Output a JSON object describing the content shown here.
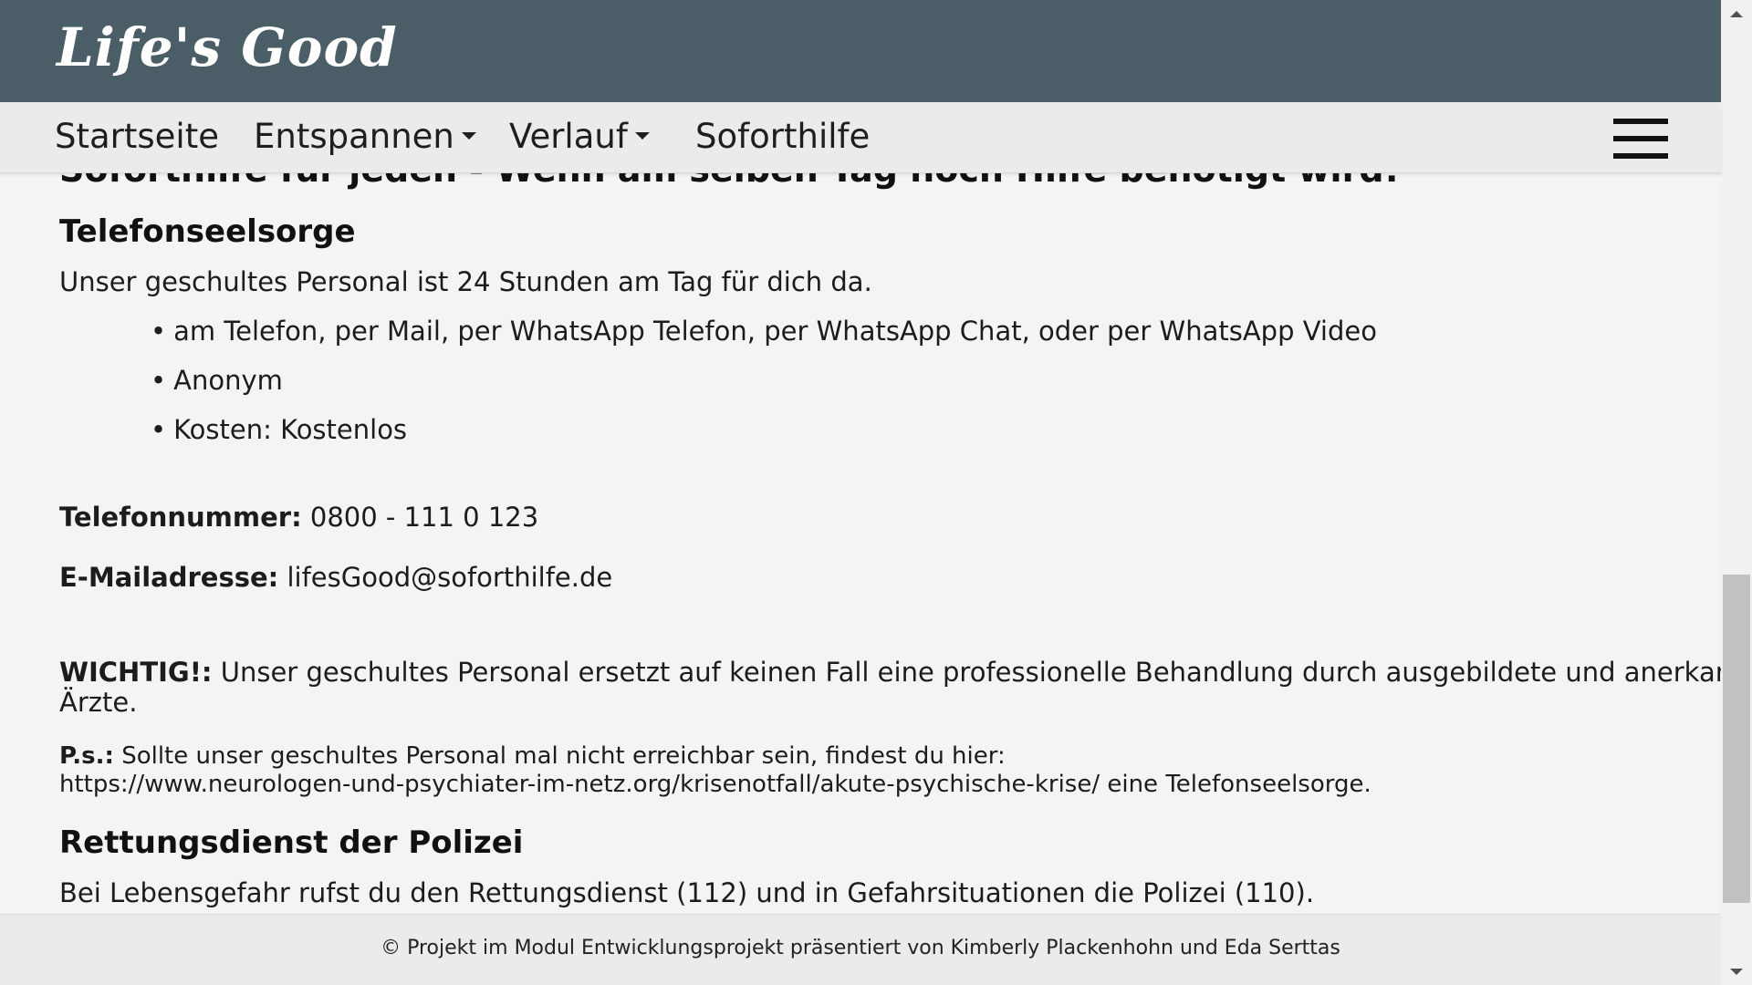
{
  "header": {
    "logo": "Life's Good"
  },
  "nav": {
    "items": [
      {
        "label": "Startseite"
      },
      {
        "label": "Entspannen"
      },
      {
        "label": "Verlauf"
      },
      {
        "label": "Soforthilfe"
      }
    ]
  },
  "main": {
    "clipped_heading": "Soforthilfe für jeden - Wenn am selben Tag noch Hilfe benötigt wird!",
    "section1": {
      "title": "Telefonseelsorge",
      "intro": "Unser geschultes Personal ist 24 Stunden am Tag für dich da.",
      "bullets": [
        "am Telefon, per Mail, per WhatsApp Telefon, per WhatsApp Chat, oder per WhatsApp Video",
        "Anonym",
        "Kosten: Kostenlos"
      ],
      "phone_label": "Telefonnummer:",
      "phone_value": "0800 - 111 0 123",
      "email_label": "E-Mailadresse:",
      "email_value": "lifesGood@soforthilfe.de",
      "important_label": "WICHTIG!:",
      "important_text_line1": "Unser geschultes Personal ersetzt auf keinen Fall eine professionelle Behandlung durch ausgebildete und anerkannte",
      "important_text_line2": "Ärzte.",
      "ps_label": "P.s.:",
      "ps_text_line1": "Sollte unser geschultes Personal mal nicht erreichbar sein, findest du hier:",
      "ps_text_line2": "https://www.neurologen-und-psychiater-im-netz.org/krisenotfall/akute-psychische-krise/ eine Telefonseelsorge."
    },
    "section2": {
      "title": "Rettungsdienst der Polizei",
      "text": "Bei Lebensgefahr rufst du den Rettungsdienst (112) und in Gefahrsituationen die Polizei (110)."
    }
  },
  "footer": {
    "text": "© Projekt im Modul Entwicklungsprojekt präsentiert von Kimberly Plackenhohn und Eda Serttas"
  }
}
